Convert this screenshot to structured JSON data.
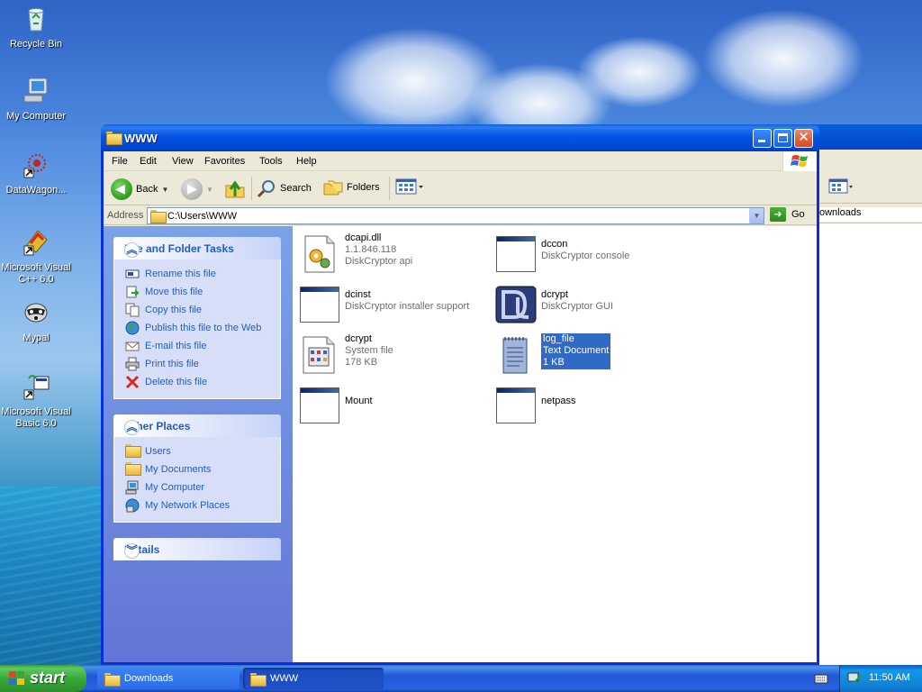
{
  "desktop": {
    "icons": [
      {
        "label": "Recycle Bin"
      },
      {
        "label": "My Computer"
      },
      {
        "label": "DataWagon..."
      },
      {
        "label": "Microsoft Visual C++ 6.0"
      },
      {
        "label": "Mypal"
      },
      {
        "label": "Microsoft Visual Basic 6.0"
      }
    ]
  },
  "background_window": {
    "address_text": "ownloads"
  },
  "window": {
    "title": "WWW",
    "menu": [
      "File",
      "Edit",
      "View",
      "Favorites",
      "Tools",
      "Help"
    ],
    "toolbar": {
      "back_label": "Back",
      "search_label": "Search",
      "folders_label": "Folders"
    },
    "address": {
      "label": "Address",
      "value": "C:\\Users\\WWW",
      "go_label": "Go"
    },
    "tasks_panel": {
      "title": "File and Folder Tasks",
      "items": [
        "Rename this file",
        "Move this file",
        "Copy this file",
        "Publish this file to the Web",
        "E-mail this file",
        "Print this file",
        "Delete this file"
      ]
    },
    "places_panel": {
      "title": "Other Places",
      "items": [
        "Users",
        "My Documents",
        "My Computer",
        "My Network Places"
      ]
    },
    "details_panel": {
      "title": "Details"
    },
    "files": [
      {
        "name": "dcapi.dll",
        "line2": "1.1.846.118",
        "line3": "DiskCryptor api"
      },
      {
        "name": "dccon",
        "line2": "DiskCryptor console",
        "line3": ""
      },
      {
        "name": "dcinst",
        "line2": "DiskCryptor installer support",
        "line3": ""
      },
      {
        "name": "dcrypt",
        "line2": "DiskCryptor GUI",
        "line3": ""
      },
      {
        "name": "dcrypt",
        "line2": "System file",
        "line3": "178 KB"
      },
      {
        "name": "log_file",
        "line2": "Text Document",
        "line3": "1 KB",
        "selected": true
      },
      {
        "name": "Mount",
        "line2": "",
        "line3": ""
      },
      {
        "name": "netpass",
        "line2": "",
        "line3": ""
      }
    ]
  },
  "taskbar": {
    "start_label": "start",
    "tasks": [
      {
        "label": "Downloads"
      },
      {
        "label": "WWW",
        "active": true
      }
    ],
    "clock": "11:50 AM"
  },
  "colors": {
    "title_blue": "#0054e3",
    "task_link": "#215dc6",
    "selection": "#316ac5"
  }
}
